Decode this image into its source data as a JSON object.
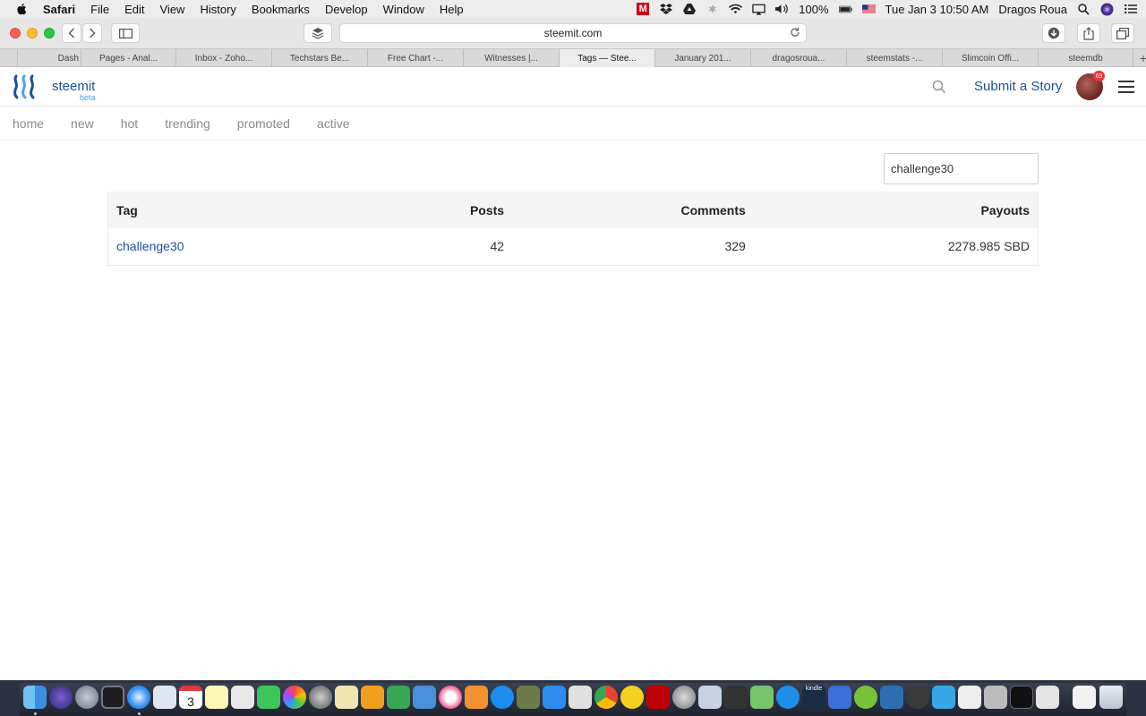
{
  "menubar": {
    "app_name": "Safari",
    "items": [
      "File",
      "Edit",
      "View",
      "History",
      "Bookmarks",
      "Develop",
      "Window",
      "Help"
    ],
    "battery": "100%",
    "datetime": "Tue Jan 3  10:50 AM",
    "user": "Dragos Roua"
  },
  "browser": {
    "url": "steemit.com",
    "tabs": [
      {
        "label": "Dash"
      },
      {
        "label": "Pages - Anal..."
      },
      {
        "label": "Inbox - Zoho..."
      },
      {
        "label": "Techstars Be..."
      },
      {
        "label": "Free Chart -..."
      },
      {
        "label": "Witnesses |..."
      },
      {
        "label": "Tags — Stee..."
      },
      {
        "label": "January 201..."
      },
      {
        "label": "dragosroua..."
      },
      {
        "label": "steemstats -..."
      },
      {
        "label": "Slimcoin Offi..."
      },
      {
        "label": "steemdb"
      }
    ],
    "new_tab": "+"
  },
  "header": {
    "brand": "steemit",
    "brand_sub": "beta",
    "submit_label": "Submit a Story",
    "notification_count": "69"
  },
  "nav": {
    "items": [
      "home",
      "new",
      "hot",
      "trending",
      "promoted",
      "active"
    ]
  },
  "filter": {
    "value": "challenge30"
  },
  "table": {
    "headers": {
      "tag": "Tag",
      "posts": "Posts",
      "comments": "Comments",
      "payouts": "Payouts"
    },
    "rows": [
      {
        "tag": "challenge30",
        "posts": "42",
        "comments": "329",
        "payouts": "2278.985 SBD"
      }
    ]
  },
  "colors": {
    "brand": "#1a5099",
    "brand_light": "#4ba2f2",
    "nav_text": "#8a8a8a"
  },
  "dock": {
    "calendar_day": "3",
    "kindle_label": "kindle"
  }
}
